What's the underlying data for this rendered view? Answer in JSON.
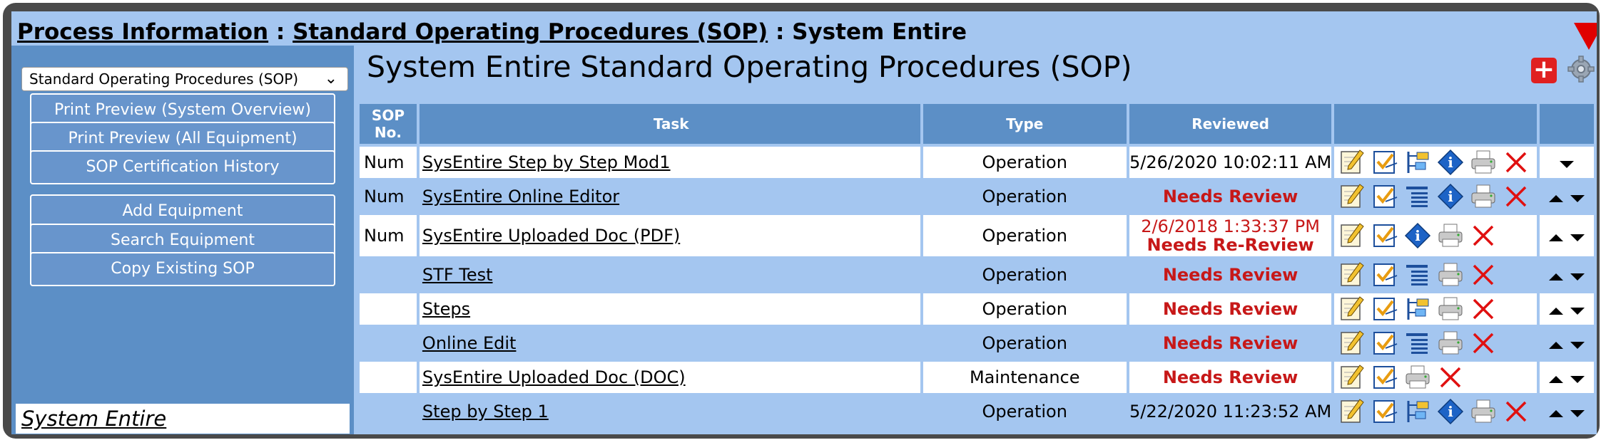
{
  "breadcrumb": {
    "part1": "Process Information",
    "sep1": " : ",
    "part2": "Standard Operating Procedures (SOP)",
    "sep2": " : ",
    "part3": "System Entire"
  },
  "sidebar": {
    "select_value": "Standard Operating Procedures (SOP)",
    "buttons": [
      "Print Preview (System Overview)",
      "Print Preview (All Equipment)",
      "SOP Certification History",
      "Add Equipment",
      "Search Equipment",
      "Copy Existing SOP"
    ],
    "system_link": "System Entire"
  },
  "main": {
    "title": "System Entire Standard Operating Procedures (SOP)",
    "add_label": "+"
  },
  "table": {
    "headers": {
      "sop": "SOP No.",
      "task": "Task",
      "type": "Type",
      "reviewed": "Reviewed"
    },
    "rows": [
      {
        "sop": "Num",
        "task": "SysEntire Step by Step Mod1",
        "type": "Operation",
        "reviewed": "5/26/2020 10:02:11 AM"
      },
      {
        "sop": "Num",
        "task": "SysEntire Online Editor",
        "type": "Operation",
        "reviewed": "Needs Review"
      },
      {
        "sop": "Num",
        "task": "SysEntire Uploaded Doc (PDF)",
        "type": "Operation",
        "reviewed": "2/6/2018 1:33:37 PM",
        "reviewed2": "Needs Re-Review"
      },
      {
        "sop": "",
        "task": "STF Test",
        "type": "Operation",
        "reviewed": "Needs Review"
      },
      {
        "sop": "",
        "task": "Steps",
        "type": "Operation",
        "reviewed": "Needs Review"
      },
      {
        "sop": "",
        "task": "Online Edit",
        "type": "Operation",
        "reviewed": "Needs Review"
      },
      {
        "sop": "",
        "task": "SysEntire Uploaded Doc (DOC)",
        "type": "Maintenance",
        "reviewed": "Needs Review"
      },
      {
        "sop": "",
        "task": "Step by Step 1",
        "type": "Operation",
        "reviewed": "5/22/2020 11:23:52 AM"
      }
    ]
  },
  "colors": {
    "accent": "#5c8fc6",
    "light": "#a4c6f0",
    "alert": "#c71818"
  }
}
